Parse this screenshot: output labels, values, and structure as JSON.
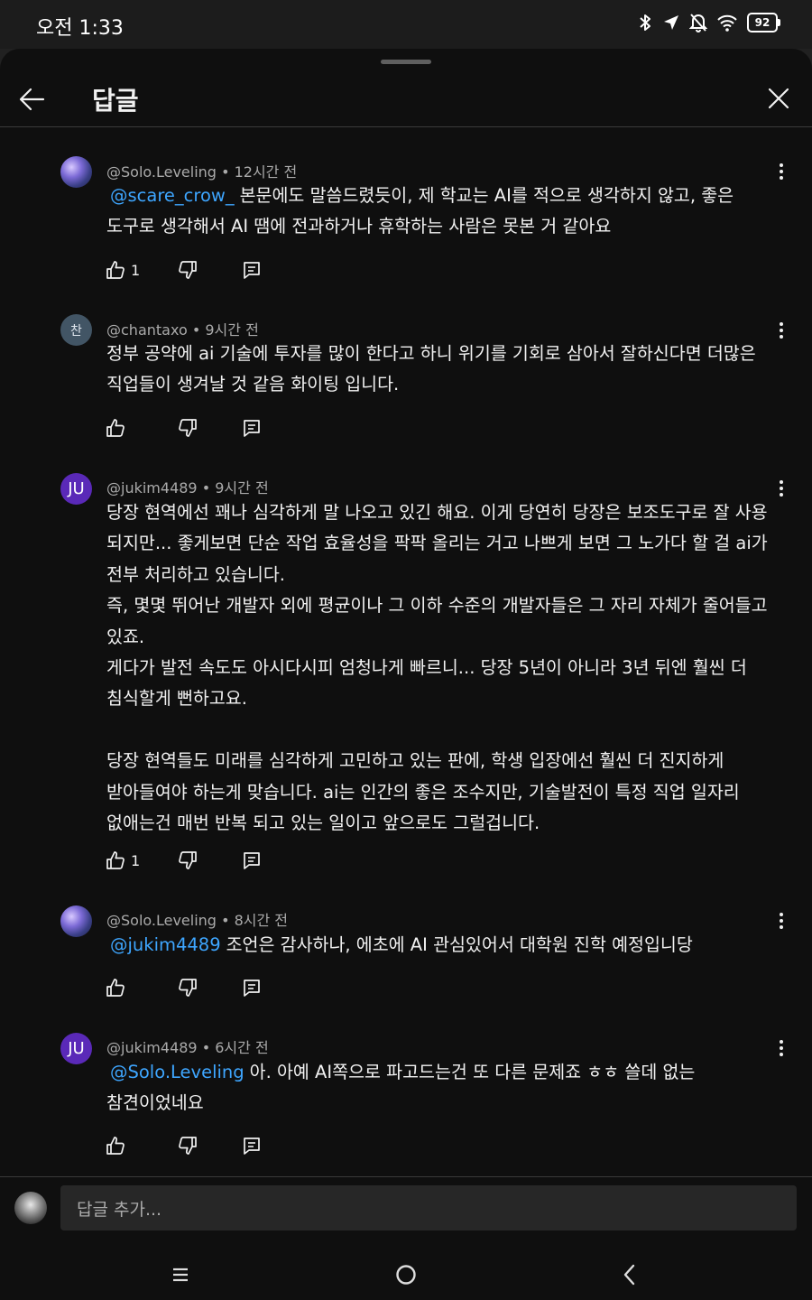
{
  "status_bar": {
    "time": "오전 1:33",
    "battery": "92"
  },
  "header": {
    "title": "답글"
  },
  "comments": [
    {
      "author": "@Solo.Leveling",
      "time": "12시간 전",
      "mention": "@scare_crow_",
      "text": "본문에도 말씀드렸듯이, 제 학교는 AI를 적으로 생각하지 않고, 좋은 도구로 생각해서 AI 땜에 전과하거나 휴학하는 사람은 못본 거 같아요",
      "likes": "1"
    },
    {
      "author": "@chantaxo",
      "avatar_text": "찬",
      "time": "9시간 전",
      "text": "정부 공약에 ai 기술에 투자를 많이 한다고 하니 위기를 기회로 삼아서 잘하신다면 더많은 직업들이 생겨날 것 같음 화이팅 입니다.",
      "likes": ""
    },
    {
      "author": "@jukim4489",
      "avatar_text": "JU",
      "time": "9시간 전",
      "text": "당장 현역에선 꽤나 심각하게 말 나오고 있긴 해요. 이게 당연히 당장은 보조도구로 잘 사용 되지만... 좋게보면 단순 작업 효율성을 팍팍 올리는 거고 나쁘게 보면 그 노가다 할 걸 ai가 전부 처리하고 있습니다.\n즉, 몇몇 뛰어난 개발자 외에 평균이나 그 이하 수준의 개발자들은 그 자리 자체가 줄어들고 있죠.\n게다가 발전 속도도 아시다시피 엄청나게 빠르니... 당장 5년이 아니라 3년 뒤엔 훨씬 더 침식할게 뻔하고요.\n\n당장 현역들도 미래를 심각하게 고민하고 있는 판에, 학생 입장에선 훨씬 더 진지하게 받아들여야 하는게 맞습니다. ai는 인간의 좋은 조수지만, 기술발전이 특정 직업 일자리 없애는건 매번 반복 되고 있는 일이고 앞으로도 그럴겁니다.",
      "likes": "1"
    },
    {
      "author": "@Solo.Leveling",
      "time": "8시간 전",
      "mention": "@jukim4489",
      "text": "조언은 감사하나, 에초에 AI 관심있어서 대학원 진학 예정입니당",
      "likes": ""
    },
    {
      "author": "@jukim4489",
      "avatar_text": "JU",
      "time": "6시간 전",
      "mention": "@Solo.Leveling",
      "text": "아. 아예 AI쪽으로 파고드는건 또 다른 문제죠 ㅎㅎ 쓸데 없는 참견이었네요",
      "likes": ""
    }
  ],
  "reply_input": {
    "placeholder": "답글 추가..."
  },
  "meta_separator": "•"
}
